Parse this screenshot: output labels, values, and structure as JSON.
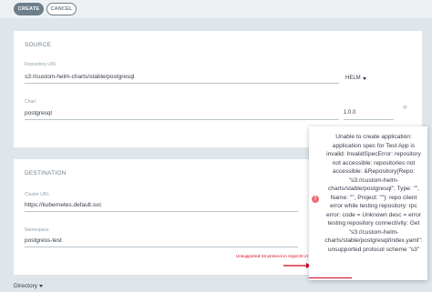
{
  "toolbar": {
    "create_label": "CREATE",
    "cancel_label": "CANCEL"
  },
  "source": {
    "title": "SOURCE",
    "repo_url_label": "Repository URL",
    "repo_url_value": "s3://custom-helm-charts/stable/postgresql",
    "repo_type": "HELM",
    "chart_label": "Chart",
    "chart_value": "postgresql",
    "chart_version": "1.0.0"
  },
  "destination": {
    "title": "DESTINATION",
    "cluster_url_label": "Cluster URL",
    "cluster_url_value": "https://kubernetes.default.svc",
    "namespace_label": "Namespace",
    "namespace_value": "postgress-test"
  },
  "directory_label": "Directory",
  "error_popup": {
    "message": "Unable to create application: application spec for Test App is invalid: InvalidSpecError: repository not accessible: repositories not accessible: &Repository{Repo: \"s3://custom-helm-charts/stable/postgresql\", Type: \"\", Name: \"\", Project: \"\"}: repo client error while testing repository: rpc error: code = Unknown desc = error testing repository connectivity: Get \"s3://custom-helm-charts/stable/postgresql/index.yaml\": unsupported protocol scheme \"s3\""
  },
  "annotation": {
    "text": "Unsupported S3 protocol in ArgoCD UI",
    "color": "#d0021b"
  },
  "colors": {
    "accent": "#6d7f8b",
    "error": "#e96d76",
    "background": "#dee6eb"
  }
}
